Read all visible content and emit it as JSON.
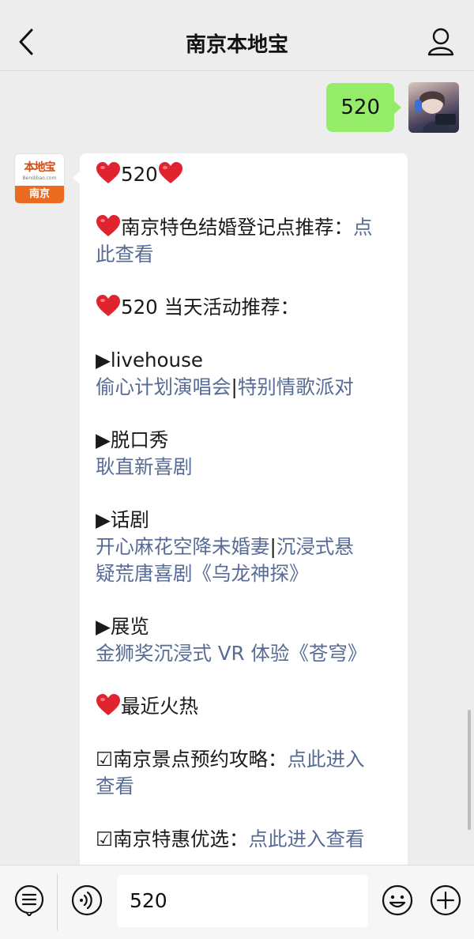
{
  "header": {
    "title": "南京本地宝",
    "back_icon": "chevron-left-icon",
    "profile_icon": "person-icon"
  },
  "outgoing_message": {
    "text": "520",
    "color": "#95ec69"
  },
  "bot_avatar": {
    "logo_text": "本地宝",
    "logo_sub": "Bendibao.com",
    "band_text": "南京"
  },
  "incoming_message": {
    "line1": "520",
    "item1_text": "南京特色结婚登记点推荐：",
    "item1_link_a": "点",
    "item1_link_b": "此查看",
    "item2_text": "520 当天活动推荐：",
    "section1_title": "▶livehouse",
    "section1_link_a": "偷心计划演唱会",
    "section1_sep": "|",
    "section1_link_b": "特别情歌派对",
    "section2_title": "▶脱口秀",
    "section2_link": "耿直新喜剧",
    "section3_title": "▶话剧",
    "section3_link_a": "开心麻花空降未婚妻",
    "section3_sep": "|",
    "section3_link_b1": "沉浸式悬",
    "section3_link_b2": "疑荒唐喜剧《乌龙神探》",
    "section4_title": "▶展览",
    "section4_link": "金狮奖沉浸式 VR 体验《苍穹》",
    "item3_text": "最近火热",
    "item4_text": "☑南京景点预约攻略：",
    "item4_link_a": "点此进入",
    "item4_link_b": "查看",
    "item5_text": "☑南京特惠优选：",
    "item5_link": "点此进入查看",
    "link_color": "#576b95",
    "heart_color": "#e0242f"
  },
  "bottom_bar": {
    "input_value": "520",
    "menu_icon": "menu-list-icon",
    "voice_icon": "voice-icon",
    "emoji_icon": "smiley-icon",
    "plus_icon": "plus-circle-icon"
  }
}
